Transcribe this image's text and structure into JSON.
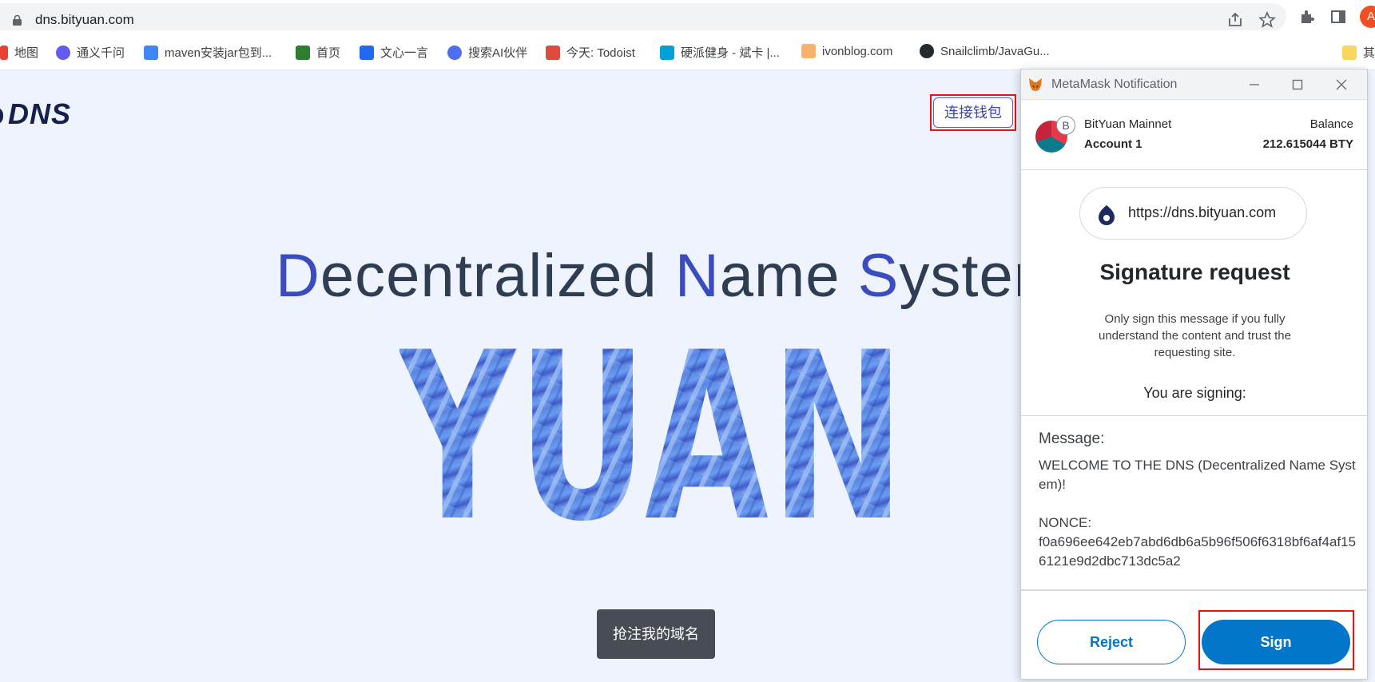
{
  "browser": {
    "url": "dns.bityuan.com",
    "avatar_letter": "A",
    "bookmarks": [
      {
        "label": "地图",
        "color": "#e94235",
        "icon": "map-icon"
      },
      {
        "label": "通义千问",
        "color": "#615ced",
        "icon": "tongyi-icon"
      },
      {
        "label": "maven安装jar包到...",
        "color": "#4285f4",
        "icon": "maven-icon"
      },
      {
        "label": "首页",
        "color": "#2e7d32",
        "icon": "home-icon"
      },
      {
        "label": "文心一言",
        "color": "#2468f2",
        "icon": "wenxin-icon"
      },
      {
        "label": "搜索AI伙伴",
        "color": "#4e6ef2",
        "icon": "ai-search-icon"
      },
      {
        "label": "今天: Todoist",
        "color": "#db4c3f",
        "icon": "todoist-icon"
      },
      {
        "label": "硬派健身 - 斌卡 |...",
        "color": "#00a1d6",
        "icon": "bilibili-icon"
      },
      {
        "label": "ivonblog.com",
        "color": "#f6b26b",
        "icon": "blog-icon"
      },
      {
        "label": "Snailclimb/JavaGu...",
        "color": "#24292e",
        "icon": "github-icon"
      },
      {
        "label": "其",
        "color": "#f9d65c",
        "icon": "folder-icon"
      }
    ]
  },
  "page": {
    "logo": "DNS",
    "connect_wallet": "连接钱包",
    "headline": {
      "word1_initial": "D",
      "word1_rest": "ecentralized ",
      "word2_initial": "N",
      "word2_rest": "ame ",
      "word3_initial": "S",
      "word3_rest": "ystem"
    },
    "hero_word": "YUAN",
    "grab_domain": "抢注我的域名",
    "accent_color": "#3b4cc0"
  },
  "metamask": {
    "window_title": "MetaMask Notification",
    "network": "BitYuan Mainnet",
    "network_badge": "B",
    "account": "Account 1",
    "balance_label": "Balance",
    "balance_value": "212.615044 BTY",
    "origin": "https://dns.bityuan.com",
    "title": "Signature request",
    "description": "Only sign this message if you fully understand the content and trust the requesting site.",
    "signing_label": "You are signing:",
    "message_label": "Message:",
    "message_line1": "WELCOME TO THE DNS (Decentralized Name System)!",
    "message_line2": "NONCE:",
    "message_line3": "f0a696ee642eb7abd6db6a5b96f506f6318bf6af4af156121e9d2dbc713dc5a2",
    "reject": "Reject",
    "sign": "Sign",
    "primary_color": "#0376c9"
  }
}
